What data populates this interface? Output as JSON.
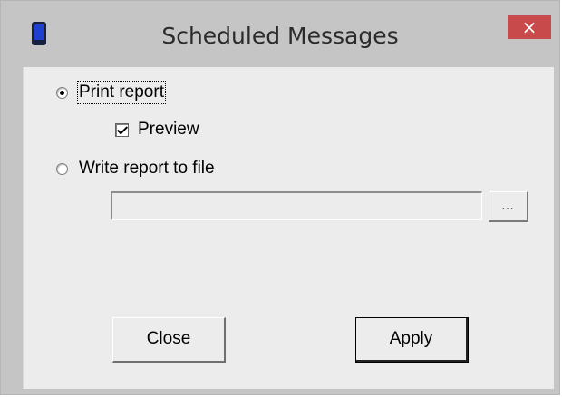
{
  "window": {
    "title": "Scheduled Messages",
    "app_icon": "mobile-phone-icon",
    "close_glyph": "×"
  },
  "options": {
    "print_report_label": "Print report",
    "preview_label": "Preview",
    "write_to_file_label": "Write report to file",
    "print_report_selected": true,
    "write_to_file_selected": false,
    "preview_checked": true
  },
  "file": {
    "path_value": "",
    "browse_label": "..."
  },
  "buttons": {
    "close_label": "Close",
    "apply_label": "Apply"
  },
  "colors": {
    "title_bar": "#c5c5c5",
    "client_bg": "#ececec",
    "close_button": "#c84a4a"
  }
}
